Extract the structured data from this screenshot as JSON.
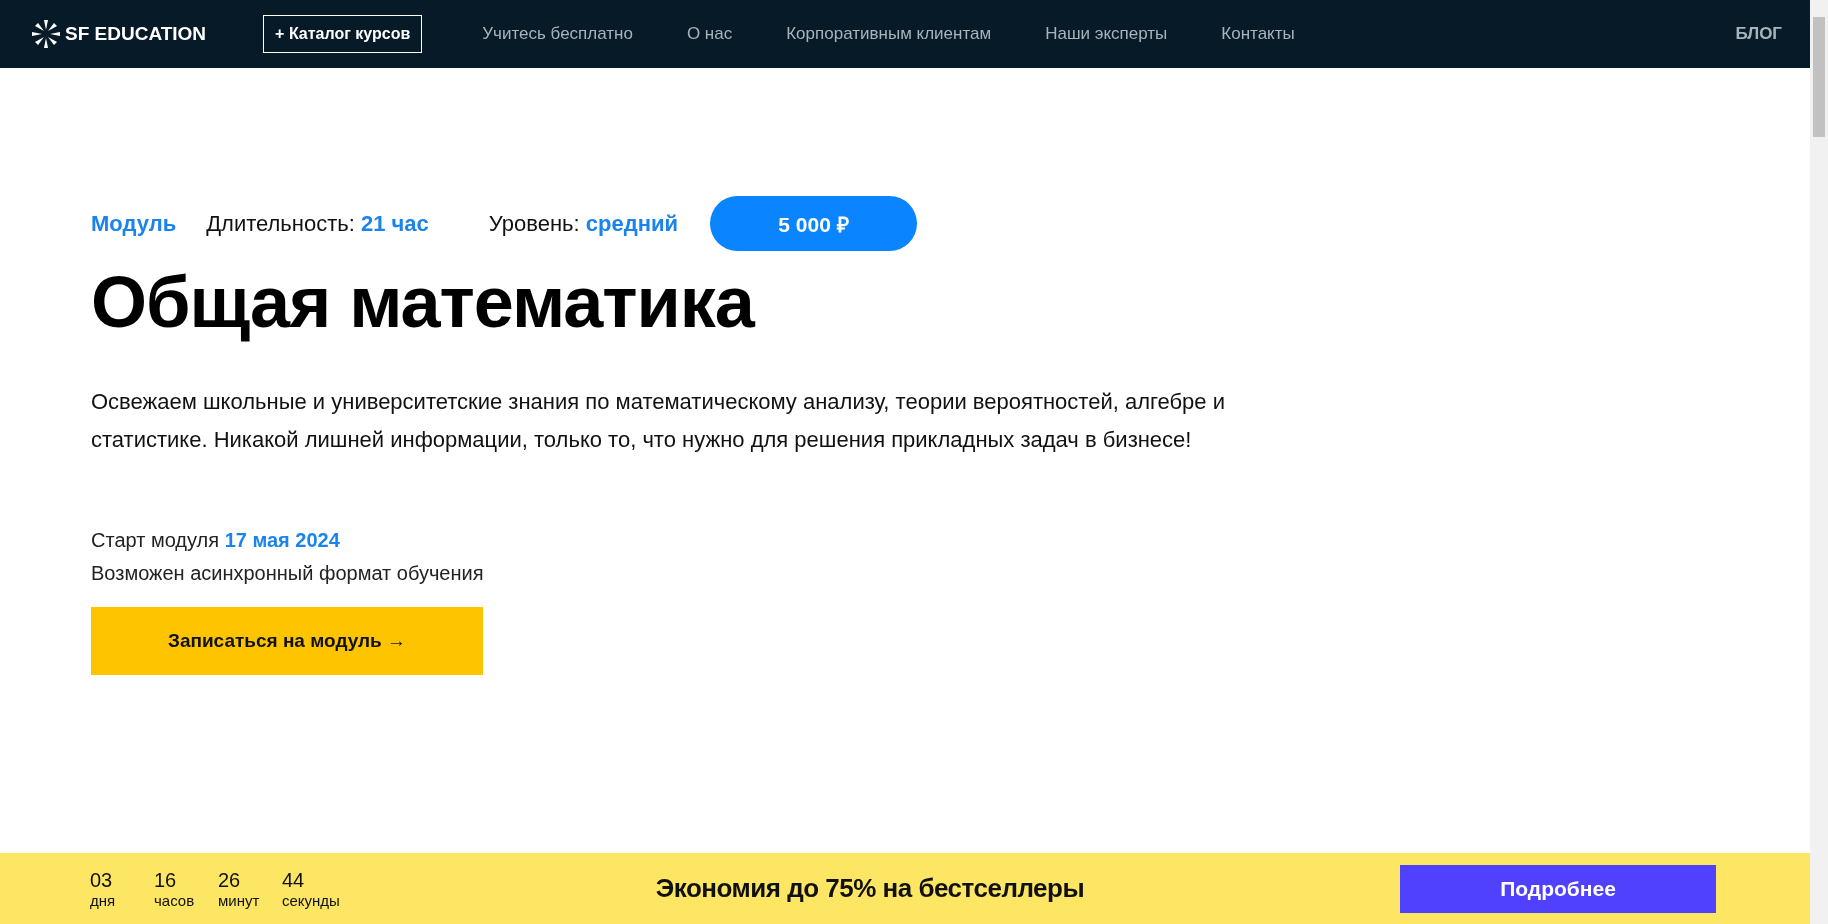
{
  "header": {
    "logo": "SF EDUCATION",
    "catalog_button": "+ Каталог курсов",
    "nav": [
      "Учитесь бесплатно",
      "О нас",
      "Корпоративным клиентам",
      "Наши эксперты",
      "Контакты"
    ],
    "blog": "БЛОГ"
  },
  "course": {
    "kind_label": "Модуль",
    "duration_label": "Длительность:",
    "duration": "21 час",
    "level_label": "Уровень:",
    "level_value": "средний",
    "price": "5 000 ₽",
    "title": "Общая математика",
    "description": "Освежаем школьные и университетские знания по математическому анализу, теории вероятностей, алгебре и статистике. Никакой лишней информации, только то, что нужно для решения прикладных задач в бизнесе!",
    "start_label": "Старт модуля",
    "start_date": "17 мая 2024",
    "format_note": "Возможен асинхронный формат обучения",
    "cta": "Записаться на модуль →"
  },
  "promo": {
    "countdown": [
      {
        "value": "03",
        "unit": "дня"
      },
      {
        "value": "16",
        "unit": "часов"
      },
      {
        "value": "26",
        "unit": "минут"
      },
      {
        "value": "44",
        "unit": "секунды"
      }
    ],
    "text": "Экономия до 75% на бестселлеры",
    "button": "Подробнее"
  }
}
